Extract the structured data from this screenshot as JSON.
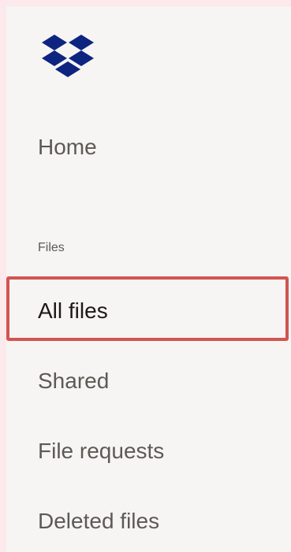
{
  "brand": {
    "logo_icon": "dropbox-logo-icon",
    "logo_color": "#0d2481"
  },
  "nav": {
    "home_label": "Home",
    "section_label": "Files",
    "items": [
      {
        "label": "All files",
        "active": true
      },
      {
        "label": "Shared",
        "active": false
      },
      {
        "label": "File requests",
        "active": false
      },
      {
        "label": "Deleted files",
        "active": false
      }
    ]
  },
  "highlight_color": "#d25450"
}
